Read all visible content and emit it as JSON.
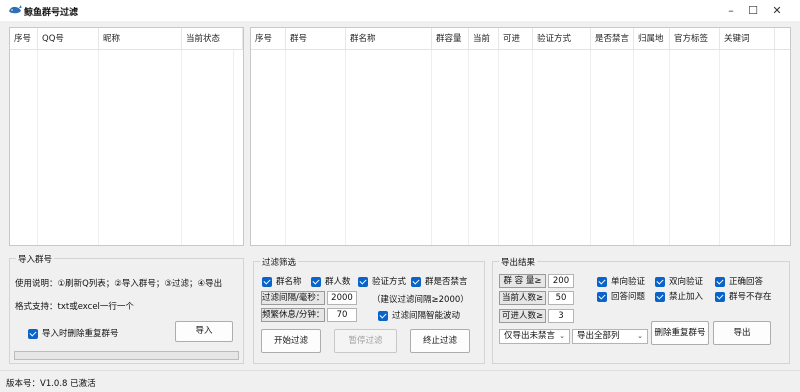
{
  "window": {
    "title": "鲸鱼群号过滤",
    "minimize": "–",
    "maximize": "☐",
    "close": "✕"
  },
  "left_table": {
    "columns": [
      "序号",
      "QQ号",
      "昵称",
      "当前状态"
    ]
  },
  "right_table": {
    "columns": [
      "序号",
      "群号",
      "群名称",
      "群容量",
      "当前",
      "可进",
      "验证方式",
      "是否禁言",
      "归属地",
      "官方标签",
      "关键词"
    ]
  },
  "import": {
    "group_label": "导入群号",
    "usage": "使用说明：①刷新Q列表；②导入群号；③过滤；④导出",
    "format": "格式支持：txt或excel一行一个",
    "dedupe_checkbox": "导入时删除重复群号",
    "import_button": "导入"
  },
  "filter": {
    "group_label": "过滤筛选",
    "checkboxes": [
      "群名称",
      "群人数",
      "验证方式",
      "群是否禁言"
    ],
    "interval_label": "过滤间隔/毫秒：",
    "interval_value": "2000",
    "interval_hint": "（建议过滤间隔≥2000）",
    "rest_label": "频繁休息/分钟：",
    "rest_value": "70",
    "smart_checkbox": "过滤间隔智能波动",
    "start_button": "开始过滤",
    "pause_button": "暂停过滤",
    "stop_button": "终止过滤"
  },
  "export": {
    "group_label": "导出结果",
    "capacity_label": "群 容 量≥",
    "capacity_value": "200",
    "current_label": "当前人数≥",
    "current_value": "50",
    "available_label": "可进人数≥",
    "available_value": "3",
    "checkboxes": [
      "单向验证",
      "双向验证",
      "正确回答",
      "回答问题",
      "禁止加入",
      "群号不存在"
    ],
    "select_mute": "仅导出未禁言",
    "select_scope": "导出全部列",
    "dedupe_button": "删除重复群号",
    "export_button": "导出"
  },
  "status": {
    "version": "版本号：V1.0.8 已激活"
  }
}
